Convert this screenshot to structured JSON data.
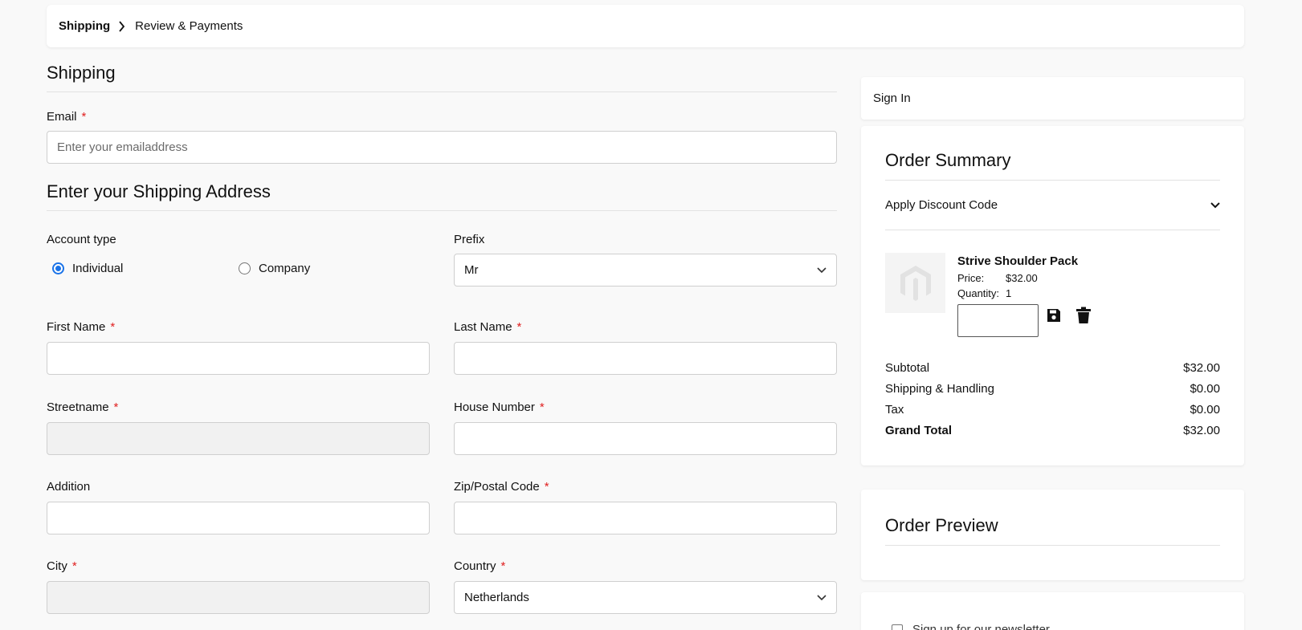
{
  "breadcrumb": {
    "items": [
      "Shipping",
      "Review & Payments"
    ]
  },
  "shipping": {
    "title": "Shipping",
    "email_label": "Email",
    "email_placeholder": "Enter your emailaddress",
    "required_mark": "*"
  },
  "address": {
    "title": "Enter your Shipping Address",
    "account_type_label": "Account type",
    "account_options": [
      "Individual",
      "Company"
    ],
    "prefix_label": "Prefix",
    "prefix_value": "Mr",
    "first_name_label": "First Name",
    "last_name_label": "Last Name",
    "streetname_label": "Streetname",
    "house_number_label": "House Number",
    "addition_label": "Addition",
    "zip_label": "Zip/Postal Code",
    "city_label": "City",
    "country_label": "Country",
    "country_value": "Netherlands"
  },
  "sidebar": {
    "sign_in": "Sign In",
    "order_summary": {
      "title": "Order Summary",
      "discount_label": "Apply Discount Code",
      "item": {
        "name": "Strive Shoulder Pack",
        "price_label": "Price:",
        "price_value": "$32.00",
        "qty_label": "Quantity:",
        "qty_value": "1"
      },
      "totals": [
        {
          "label": "Subtotal",
          "value": "$32.00"
        },
        {
          "label": "Shipping & Handling",
          "value": "$0.00"
        },
        {
          "label": "Tax",
          "value": "$0.00"
        },
        {
          "label": "Grand Total",
          "value": "$32.00"
        }
      ]
    },
    "order_preview_title": "Order Preview",
    "newsletter_label": "Sign up for our newsletter"
  },
  "colors": {
    "required": "#e02020",
    "radio_accent": "#1a73e8",
    "background": "#f9f9f9"
  }
}
